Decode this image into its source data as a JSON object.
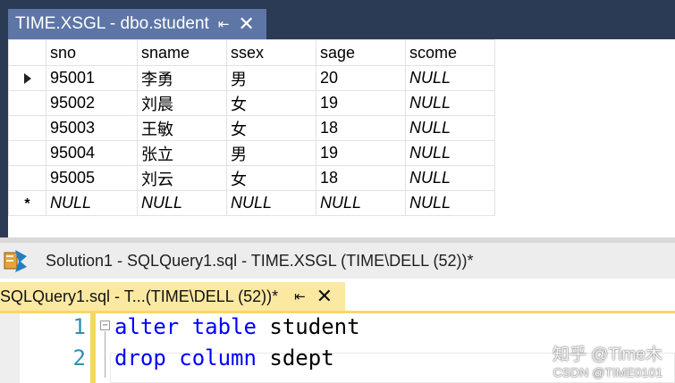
{
  "table_window": {
    "tab_title": "TIME.XSGL - dbo.student",
    "columns": [
      "sno",
      "sname",
      "ssex",
      "sage",
      "scome"
    ],
    "rows": [
      [
        "95001",
        "李勇",
        "男",
        "20",
        "NULL"
      ],
      [
        "95002",
        "刘晨",
        "女",
        "19",
        "NULL"
      ],
      [
        "95003",
        "王敏",
        "女",
        "18",
        "NULL"
      ],
      [
        "95004",
        "张立",
        "男",
        "19",
        "NULL"
      ],
      [
        "95005",
        "刘云",
        "女",
        "18",
        "NULL"
      ]
    ],
    "new_row_marker": "*",
    "new_row": [
      "NULL",
      "NULL",
      "NULL",
      "NULL",
      "NULL"
    ]
  },
  "title_bar": {
    "title": "Solution1 - SQLQuery1.sql - TIME.XSGL (TIME\\DELL (52))*"
  },
  "query_window": {
    "tab_title": "SQLQuery1.sql - T...(TIME\\DELL (52))*",
    "lines": [
      {
        "number": "1",
        "keyword": "alter table",
        "rest": " student"
      },
      {
        "number": "2",
        "keyword": "drop column",
        "rest": " sdept"
      }
    ]
  },
  "watermark": {
    "line1": "知乎 @Time木",
    "line2": "CSDN @TIME0101"
  },
  "icons": {
    "pin": "pin-icon",
    "close": "close-icon",
    "app": "ssms-app-icon",
    "current_row": "row-pointer-icon",
    "fold": "collapse-icon"
  },
  "colors": {
    "frame": "#2b3a55",
    "active_tab": "#5e76a6",
    "query_tab": "#fbe9a2",
    "keyword": "#0000ff",
    "line_number": "#2b91af"
  }
}
